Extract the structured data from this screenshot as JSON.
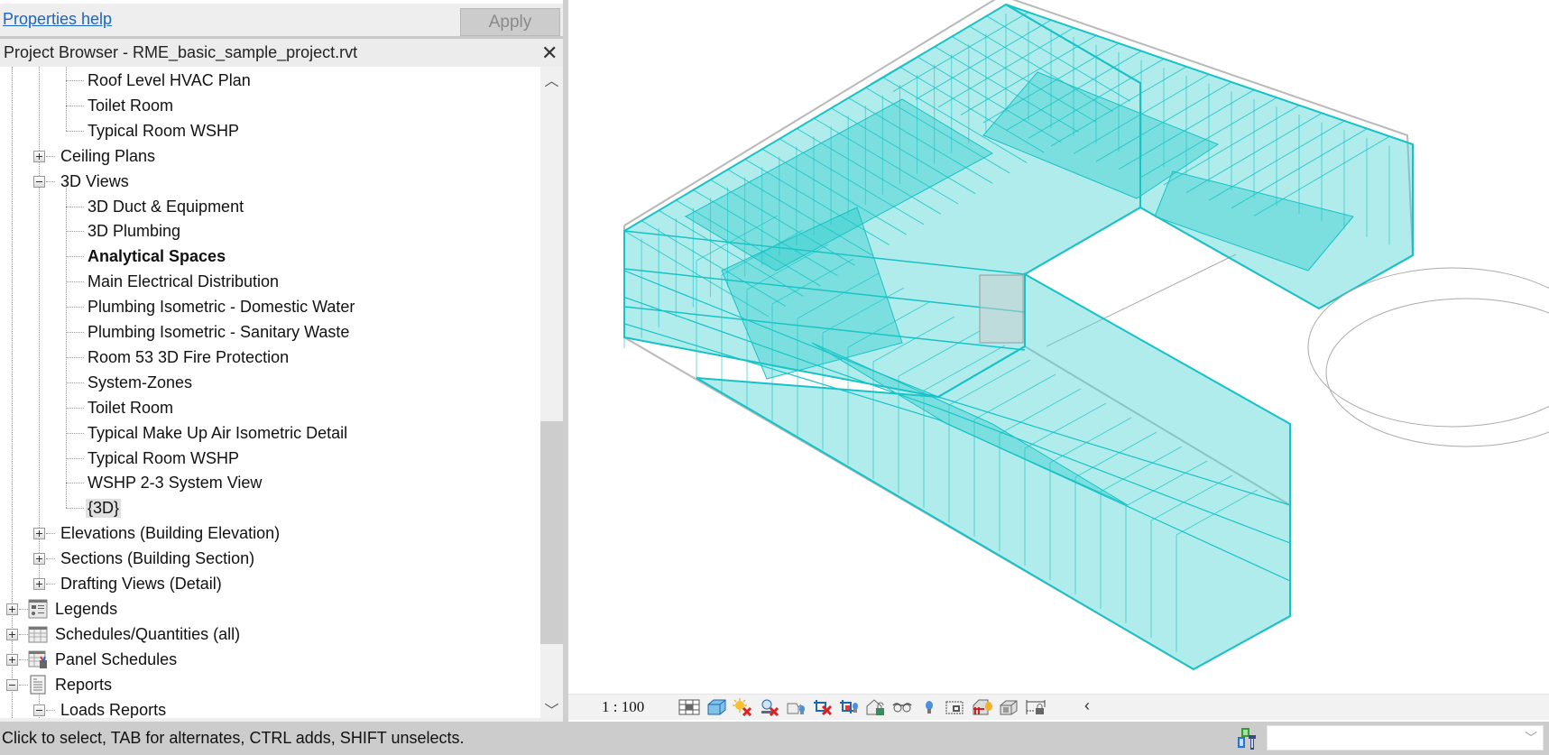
{
  "properties": {
    "help_link": "Properties help",
    "apply_label": "Apply"
  },
  "project_browser": {
    "title": "Project Browser - RME_basic_sample_project.rvt",
    "close_icon": "close-icon",
    "tree": [
      {
        "label": "Roof Level HVAC Plan",
        "level": 3,
        "type": "leaf"
      },
      {
        "label": "Toilet Room",
        "level": 3,
        "type": "leaf"
      },
      {
        "label": "Typical Room WSHP",
        "level": 3,
        "type": "leaf",
        "last": true
      },
      {
        "label": "Ceiling Plans",
        "level": 2,
        "type": "collapsed"
      },
      {
        "label": "3D Views",
        "level": 2,
        "type": "expanded"
      },
      {
        "label": "3D Duct & Equipment",
        "level": 3,
        "type": "leaf"
      },
      {
        "label": "3D Plumbing",
        "level": 3,
        "type": "leaf"
      },
      {
        "label": "Analytical Spaces",
        "level": 3,
        "type": "leaf",
        "bold": true
      },
      {
        "label": "Main Electrical Distribution",
        "level": 3,
        "type": "leaf"
      },
      {
        "label": "Plumbing Isometric - Domestic Water",
        "level": 3,
        "type": "leaf"
      },
      {
        "label": "Plumbing Isometric - Sanitary Waste",
        "level": 3,
        "type": "leaf"
      },
      {
        "label": "Room 53 3D Fire Protection",
        "level": 3,
        "type": "leaf"
      },
      {
        "label": "System-Zones",
        "level": 3,
        "type": "leaf"
      },
      {
        "label": "Toilet Room",
        "level": 3,
        "type": "leaf"
      },
      {
        "label": "Typical Make Up Air Isometric Detail",
        "level": 3,
        "type": "leaf"
      },
      {
        "label": "Typical Room WSHP",
        "level": 3,
        "type": "leaf"
      },
      {
        "label": "WSHP 2-3 System View",
        "level": 3,
        "type": "leaf"
      },
      {
        "label": "{3D}",
        "level": 3,
        "type": "leaf",
        "selected": true,
        "last": true
      },
      {
        "label": "Elevations (Building Elevation)",
        "level": 2,
        "type": "collapsed"
      },
      {
        "label": "Sections (Building Section)",
        "level": 2,
        "type": "collapsed"
      },
      {
        "label": "Drafting Views (Detail)",
        "level": 2,
        "type": "collapsed"
      },
      {
        "label": "Legends",
        "level": 1,
        "type": "collapsed",
        "icon": "legend-icon"
      },
      {
        "label": "Schedules/Quantities (all)",
        "level": 1,
        "type": "collapsed",
        "icon": "schedule-icon"
      },
      {
        "label": "Panel Schedules",
        "level": 1,
        "type": "collapsed",
        "icon": "panel-schedule-icon"
      },
      {
        "label": "Reports",
        "level": 1,
        "type": "expanded",
        "icon": "report-icon"
      },
      {
        "label": "Loads Reports",
        "level": 2,
        "type": "expanded"
      }
    ],
    "scroll_fraction": 0.62
  },
  "view_control_bar": {
    "scale": "1 : 100",
    "icons": [
      "detail-level-icon",
      "visual-style-icon",
      "sun-path-off-icon",
      "shadows-off-icon",
      "rendering-dialog-icon",
      "crop-view-off-icon",
      "show-crop-region-icon",
      "unlocked-3d-view-icon",
      "temporary-hide-isolate-icon",
      "reveal-hidden-elements-icon",
      "temporary-view-properties-icon",
      "worksharing-display-icon",
      "analytical-model-icon",
      "constraints-icon"
    ],
    "collapse_icon": "chevron-left-icon"
  },
  "status_bar": {
    "text": "Click to select, TAB for alternates, CTRL adds, SHIFT unselects.",
    "worksets_icon": "worksets-icon",
    "active_workset": ""
  },
  "colors": {
    "space_fill": "#4fd4d4",
    "space_edge": "#17c2c6",
    "link": "#1a66c4"
  }
}
